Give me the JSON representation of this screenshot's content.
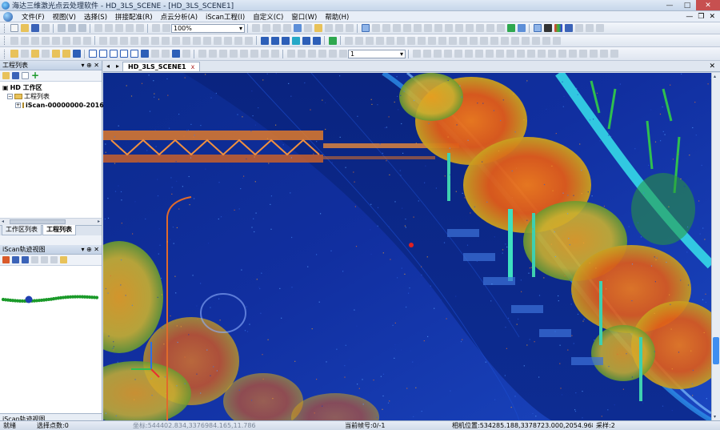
{
  "window": {
    "title": "海达三维激光点云处理软件 - HD_3LS_SCENE - [HD_3LS_SCENE1]",
    "minimize": "—",
    "maximize": "□",
    "close": "✕"
  },
  "menu": {
    "items": [
      "文件(F)",
      "视图(V)",
      "选择(S)",
      "拼接配准(R)",
      "点云分析(A)",
      "iScan工程(I)",
      "自定义(C)",
      "窗口(W)",
      "帮助(H)"
    ],
    "mdi_controls": [
      "—",
      "❐",
      "✕"
    ]
  },
  "toolbar": {
    "zoom_value": "100%",
    "frame_value": "1"
  },
  "project_panel": {
    "title": "工程列表",
    "pin": "▾ ⊕ ✕",
    "tree": {
      "root": "HD 工作区",
      "project_list": "工程列表",
      "child": "iScan-00000000-2016"
    },
    "tabs": [
      "工作区列表",
      "工程列表"
    ]
  },
  "track_panel": {
    "title": "iScan轨迹视图",
    "pin": "▾ ⊕ ✕",
    "bottom_tab": "iScan轨迹视图"
  },
  "document": {
    "tab_label": "HD_3LS_SCENE1",
    "tab_close": "x",
    "nav_left": "◂",
    "nav_right": "▸",
    "close_all": "✕"
  },
  "status": {
    "ready": "就绪",
    "selected_points": "选择点数:0",
    "coordinates": "坐标:544402.834,3376984.165,11.786",
    "frame": "当前帧号:0/-1",
    "camera": "相机位置:534285.188,3378723.000,2054.968",
    "sampling": "采样:2"
  },
  "colors": {
    "accent": "#3f8ef0",
    "trajectory": "#1b9a2a",
    "trajectory_marker": "#1f3fb0",
    "cloud_low": "#0b2a8c",
    "cloud_high": "#e8501a"
  }
}
